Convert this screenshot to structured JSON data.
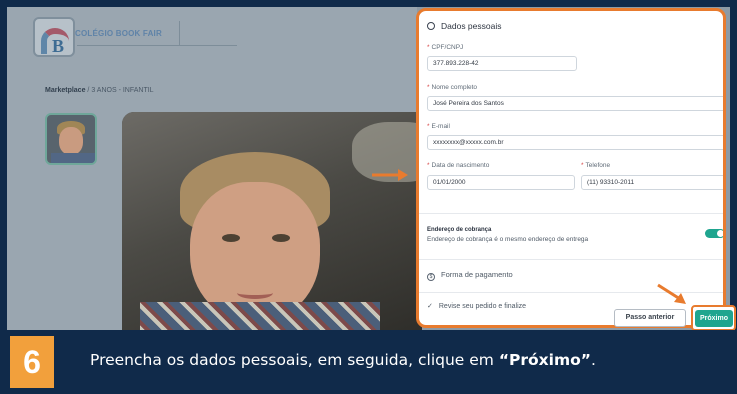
{
  "app": {
    "school_name": "COLÉGIO BOOK FAIR",
    "breadcrumb": [
      "Marketplace",
      "/",
      "3 ANOS - INFANTIL"
    ]
  },
  "form": {
    "section_title": "Dados pessoais",
    "cpf": {
      "label": "CPF/CNPJ",
      "value": "377.893.228-42"
    },
    "name": {
      "label": "Nome completo",
      "value": "José Pereira dos Santos"
    },
    "email": {
      "label": "E-mail",
      "value": "xxxxxxxx@xxxxx.com.br"
    },
    "birth": {
      "label": "Data de nascimento",
      "value": "01/01/2000"
    },
    "phone": {
      "label": "Telefone",
      "value": "(11) 93310-2011"
    },
    "billing": {
      "title": "Endereço de cobrança",
      "description": "Endereço de cobrança é o mesmo endereço de entrega",
      "toggle_on": true
    },
    "payment_section": "Forma de pagamento",
    "review_section": "Revise seu pedido e finalize",
    "prev_button": "Passo anterior",
    "next_button": "Próximo"
  },
  "caption": {
    "step_number": "6",
    "text_before": "Preencha os dados pessoais, em seguida, clique em ",
    "text_bold": "“Próximo”",
    "text_after": "."
  },
  "colors": {
    "accent_teal": "#1fa58f",
    "highlight_orange": "#e87b2e",
    "step_badge": "#f2a03c",
    "background_navy": "#102a4a"
  },
  "icons": [
    "user-icon",
    "payment-icon",
    "check-icon",
    "arrow-right-icon",
    "arrow-down-right-icon"
  ]
}
